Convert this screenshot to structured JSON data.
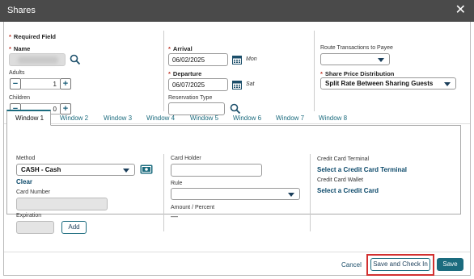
{
  "dialog": {
    "title": "Shares"
  },
  "left": {
    "required_note": "Required Field",
    "name_label": "Name",
    "adults_label": "Adults",
    "adults_value": "1",
    "children_label": "Children",
    "children_value": "0"
  },
  "middle": {
    "arrival_label": "Arrival",
    "arrival_value": "06/02/2025",
    "arrival_day": "Mon",
    "departure_label": "Departure",
    "departure_value": "06/07/2025",
    "departure_day": "Sat",
    "reservation_type_label": "Reservation Type",
    "reservation_type_value": ""
  },
  "right": {
    "route_label": "Route Transactions to Payee",
    "route_value": "",
    "distribution_label": "Share Price Distribution",
    "distribution_value": "Split Rate Between Sharing Guests"
  },
  "tabs": [
    {
      "label": "Window 1"
    },
    {
      "label": "Window 2"
    },
    {
      "label": "Window 3"
    },
    {
      "label": "Window 4"
    },
    {
      "label": "Window 5"
    },
    {
      "label": "Window 6"
    },
    {
      "label": "Window 7"
    },
    {
      "label": "Window 8"
    }
  ],
  "window_panel": {
    "method_label": "Method",
    "method_value": "CASH - Cash",
    "clear_link": "Clear",
    "card_number_label": "Card Number",
    "expiration_label": "Expiration",
    "add_button": "Add",
    "card_holder_label": "Card Holder",
    "rule_label": "Rule",
    "amount_label": "Amount / Percent",
    "amount_value": "—",
    "terminal_label": "Credit Card Terminal",
    "terminal_link": "Select a Credit Card Terminal",
    "wallet_label": "Credit Card Wallet",
    "wallet_link": "Select a Credit Card"
  },
  "footer": {
    "cancel": "Cancel",
    "save_check_in": "Save and Check In",
    "save": "Save"
  },
  "colors": {
    "titlebar": "#4a4a4a",
    "accent": "#1b6b7e",
    "required": "#c0392b",
    "highlight": "#d23030"
  }
}
